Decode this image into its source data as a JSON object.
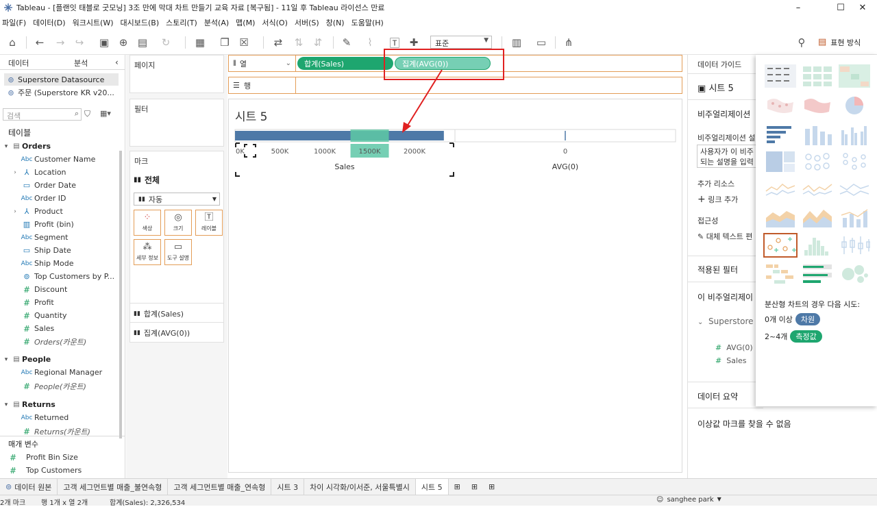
{
  "app": {
    "title": "Tableau - [플랜잇 태블로 굿모닝] 3조 만에 막대 차트 만들기 교육 자료 [복구됨] - 11일 후 Tableau 라이선스 만료",
    "window_controls": [
      "–",
      "☐",
      "✕"
    ]
  },
  "menu": [
    "파일(F)",
    "데이터(D)",
    "워크시트(W)",
    "대시보드(B)",
    "스토리(T)",
    "분석(A)",
    "맵(M)",
    "서식(O)",
    "서버(S)",
    "창(N)",
    "도움말(H)"
  ],
  "toolbar": {
    "fit_value": "표준",
    "show_me_label": "표현 방식"
  },
  "data_pane": {
    "tab_data": "데이터",
    "tab_analysis": "분석",
    "datasource_1": "Superstore Datasource",
    "datasource_2": "주문 (Superstore KR v20...",
    "search_placeholder": "검색",
    "tables_header": "테이블",
    "groups": [
      {
        "name": "Orders",
        "fields": [
          {
            "type": "Abc",
            "name": "Customer Name"
          },
          {
            "type": "geo",
            "name": "Location",
            "expand": true
          },
          {
            "type": "date",
            "name": "Order Date"
          },
          {
            "type": "Abc",
            "name": "Order ID"
          },
          {
            "type": "geo",
            "name": "Product",
            "expand": true
          },
          {
            "type": "bin",
            "name": "Profit (bin)"
          },
          {
            "type": "Abc",
            "name": "Segment"
          },
          {
            "type": "date",
            "name": "Ship Date"
          },
          {
            "type": "Abc",
            "name": "Ship Mode"
          },
          {
            "type": "set",
            "name": "Top Customers by P..."
          },
          {
            "type": "#",
            "name": "Discount"
          },
          {
            "type": "#",
            "name": "Profit"
          },
          {
            "type": "#",
            "name": "Quantity"
          },
          {
            "type": "#",
            "name": "Sales"
          },
          {
            "type": "#",
            "name": "Orders(카운트)",
            "italic": true
          }
        ]
      },
      {
        "name": "People",
        "fields": [
          {
            "type": "Abc",
            "name": "Regional Manager"
          },
          {
            "type": "#",
            "name": "People(카운트)",
            "italic": true
          }
        ]
      },
      {
        "name": "Returns",
        "fields": [
          {
            "type": "Abc",
            "name": "Returned"
          },
          {
            "type": "#",
            "name": "Returns(카운트)",
            "italic": true
          }
        ]
      }
    ],
    "params_header": "매개 변수",
    "params": [
      "Profit Bin Size",
      "Top Customers"
    ]
  },
  "cards": {
    "pages": "페이지",
    "filters": "필터",
    "marks": "마크",
    "marks_all": "전체",
    "mark_type": "자동",
    "mark_buttons": [
      "색상",
      "크기",
      "레이블",
      "세부 정보",
      "도구 설명"
    ],
    "measures": [
      "합계(Sales)",
      "집계(AVG(0))"
    ]
  },
  "shelves": {
    "columns_label": "열",
    "rows_label": "행",
    "col_pills": [
      "합계(Sales)",
      "집계(AVG(0))"
    ]
  },
  "view": {
    "sheet_title": "시트 5",
    "sales_ticks": [
      "0K",
      "500K",
      "1000K",
      "1500K",
      "2000K"
    ],
    "sales_axis_title": "Sales",
    "avg_tick": "0",
    "avg_axis_title": "AVG(0)"
  },
  "chart_data": {
    "type": "bar",
    "categories": [
      "Sales"
    ],
    "series": [
      {
        "values": [
          2326534
        ]
      }
    ],
    "xlabel": "Sales",
    "xlim": [
      0,
      2450000
    ],
    "ticks": [
      "0K",
      "500K",
      "1000K",
      "1500K",
      "2000K"
    ],
    "secondary": {
      "xlabel": "AVG(0)",
      "value": 0,
      "tick": "0"
    }
  },
  "guide": {
    "title": "데이터 가이드",
    "sheet": "시트 5",
    "viz_header": "비주얼리제이션",
    "viz_desc_label": "비주얼리제이션 설",
    "viz_desc_text_1": "사용자가 이 비주",
    "viz_desc_text_2": "되는 설명을 입력",
    "add_resource": "추가 리소스",
    "add_link": "링크 추가",
    "accessibility": "접근성",
    "alt_text": "대체 텍스트 편",
    "applied_filters": "적용된 필터",
    "this_viz": "이 비주얼리제이",
    "datasource": "Superstore",
    "fields": [
      "AVG(0)",
      "Sales"
    ],
    "data_summary": "데이터 요약",
    "outliers": "이상값 마크를 찾을 수 없음"
  },
  "show_me": {
    "hint": "분산형 차트의 경우 다음 시도:",
    "line1_prefix": "0개 이상",
    "line1_badge": "차원",
    "line2_prefix": "2~4개",
    "line2_badge": "측정값"
  },
  "tabs": [
    "데이터 원본",
    "고객 세그먼트별 매출_불연속형",
    "고객 세그먼트별 매출_연속형",
    "시트 3",
    "차이 시각화/이서준, 서울특별시",
    "시트 5"
  ],
  "status": {
    "marks": "2개 마크",
    "rows_cols": "행 1개 x 열 2개",
    "sum": "합계(Sales): 2,326,534",
    "user": "sanghee park"
  },
  "colors": {
    "bar": "#4e79a7",
    "highlight": "#76cfb4",
    "pill_dim": "#1ea66f",
    "pill_meas": "#5ec9a4",
    "annotation": "#e02020",
    "shelf_border": "#e39c56"
  }
}
